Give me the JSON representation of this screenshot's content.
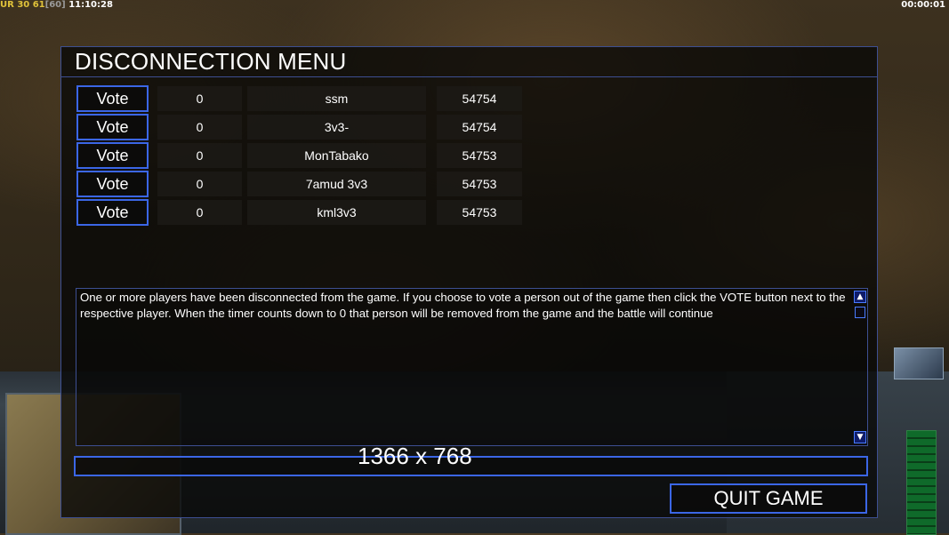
{
  "hud": {
    "ur_label": "UR",
    "ur_value": "30",
    "fps": "61",
    "fps_cap": "[60]",
    "clock": "11:10:28",
    "game_timer": "00:00:01"
  },
  "dialog": {
    "title": "DISCONNECTION MENU",
    "vote_label": "Vote",
    "players": [
      {
        "timer": "0",
        "name": "ssm",
        "ping": "54754"
      },
      {
        "timer": "0",
        "name": "3v3-",
        "ping": "54754"
      },
      {
        "timer": "0",
        "name": "MonTabako",
        "ping": "54753"
      },
      {
        "timer": "0",
        "name": "7amud 3v3",
        "ping": "54753"
      },
      {
        "timer": "0",
        "name": "kml3v3",
        "ping": "54753"
      }
    ],
    "message": "One or more players have been disconnected from the game. If you choose to vote a person out of the game then click the VOTE button next to the respective player. When the timer counts down to 0 that person will be removed from the game and the battle will continue",
    "chat_input_value": "",
    "quit_label": "QUIT GAME"
  },
  "overlay": {
    "resolution": "1366 x 768"
  },
  "colors": {
    "accent_border": "#3b66e6",
    "panel_border": "#3d4f92",
    "hud_yellow": "#e0c23a"
  }
}
